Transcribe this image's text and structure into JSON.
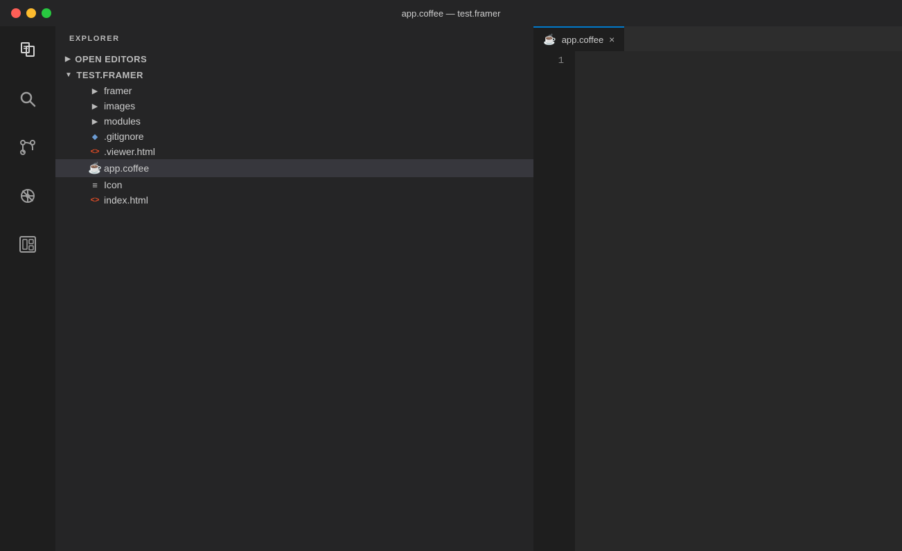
{
  "titlebar": {
    "title": "app.coffee — test.framer",
    "traffic_lights": [
      "close",
      "minimize",
      "maximize"
    ]
  },
  "activity_bar": {
    "icons": [
      {
        "name": "files-icon",
        "label": "Explorer",
        "active": true
      },
      {
        "name": "search-icon",
        "label": "Search",
        "active": false
      },
      {
        "name": "source-control-icon",
        "label": "Source Control",
        "active": false
      },
      {
        "name": "extensions-icon",
        "label": "Extensions",
        "active": false
      },
      {
        "name": "layout-icon",
        "label": "Layout",
        "active": false
      }
    ]
  },
  "sidebar": {
    "header": "EXPLORER",
    "sections": [
      {
        "id": "open-editors",
        "label": "OPEN EDITORS",
        "expanded": false
      },
      {
        "id": "test-framer",
        "label": "TEST.FRAMER",
        "expanded": true,
        "items": [
          {
            "id": "framer",
            "type": "folder",
            "label": "framer",
            "indent": 1,
            "expanded": false
          },
          {
            "id": "images",
            "type": "folder",
            "label": "images",
            "indent": 1,
            "expanded": false
          },
          {
            "id": "modules",
            "type": "folder",
            "label": "modules",
            "indent": 1,
            "expanded": false
          },
          {
            "id": "gitignore",
            "type": "git",
            "label": ".gitignore",
            "indent": 1
          },
          {
            "id": "viewer-html",
            "type": "html",
            "label": ".viewer.html",
            "indent": 1
          },
          {
            "id": "app-coffee",
            "type": "coffee",
            "label": "app.coffee",
            "indent": 1,
            "active": true
          },
          {
            "id": "icon",
            "type": "text",
            "label": "Icon",
            "indent": 1
          },
          {
            "id": "index-html",
            "type": "html",
            "label": "index.html",
            "indent": 1
          }
        ]
      }
    ]
  },
  "editor": {
    "tab": {
      "label": "app.coffee",
      "close_label": "×"
    },
    "line_numbers": [
      "1"
    ],
    "current_line": 1
  }
}
